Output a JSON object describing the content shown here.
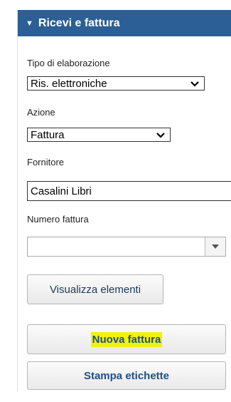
{
  "panel": {
    "title": "Ricevi e fattura",
    "header_color": "#2b5f95"
  },
  "processing_type": {
    "label": "Tipo di elaborazione",
    "selected": "Ris. elettroniche"
  },
  "action": {
    "label": "Azione",
    "selected": "Fattura"
  },
  "vendor": {
    "label": "Fornitore",
    "value": "Casalini Libri"
  },
  "invoice_number": {
    "label": "Numero fattura",
    "value": ""
  },
  "buttons": {
    "view_items": "Visualizza elementi",
    "new_invoice": "Nuova fattura",
    "print_labels": "Stampa etichette"
  },
  "icons": {
    "header": "triangle-down-icon",
    "select": "chevron-down-icon",
    "combo": "caret-down-icon"
  },
  "colors": {
    "highlight": "#f4f10a",
    "button_text": "#1b4f8c"
  }
}
